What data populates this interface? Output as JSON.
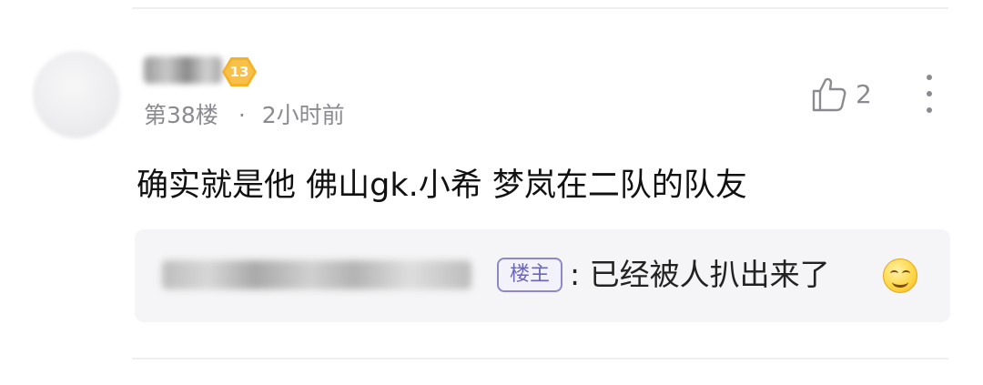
{
  "post": {
    "level": "13",
    "floor": "第38楼",
    "separator": "·",
    "time": "2小时前",
    "likes": "2",
    "comment": "确实就是他 佛山gk.小希 梦岚在二队的队友"
  },
  "reply": {
    "owner_tag": "楼主",
    "text": ": 已经被人扒出来了"
  },
  "icons": {
    "like": "thumbs-up-outline-icon",
    "more": "vertical-dots-icon",
    "emoji": "smile-emoji-icon"
  },
  "colors": {
    "level_badge": "#f5b227",
    "owner_tag": "#6d66b5",
    "meta_text": "#8a8a8f"
  }
}
